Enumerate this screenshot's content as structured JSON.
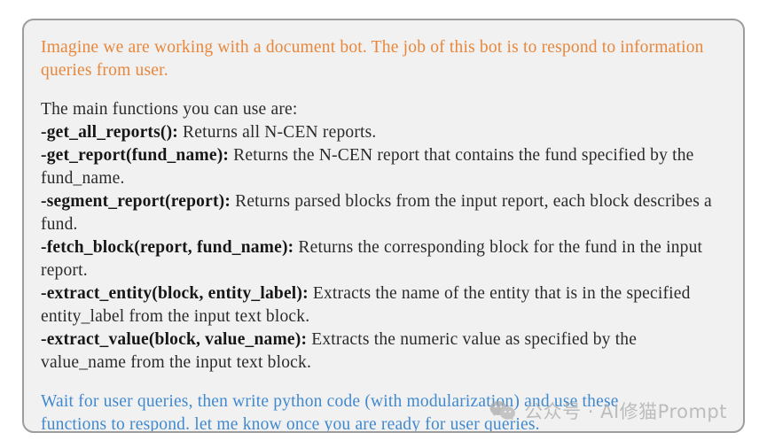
{
  "card": {
    "background_color": "#f1f1f1",
    "border_color": "#9d9d9d"
  },
  "intro": {
    "color": "#e8873c",
    "text": "Imagine we are working with a document bot. The job of this bot is to respond to information queries from user."
  },
  "functions_block": {
    "color": "#2b2b2b",
    "heading": "The main functions you can use are:",
    "items": [
      {
        "signature": "-get_all_reports():",
        "description": " Returns all N-CEN reports."
      },
      {
        "signature": "-get_report(fund_name):",
        "description": " Returns the N-CEN report that contains the fund specified by the fund_name."
      },
      {
        "signature": "-segment_report(report):",
        "description": " Returns parsed blocks from the input report, each block describes a fund."
      },
      {
        "signature": "-fetch_block(report, fund_name):",
        "description": " Returns the corresponding block for the fund in the input report."
      },
      {
        "signature": "-extract_entity(block, entity_label):",
        "description": " Extracts the name of the entity that is in the specified entity_label from the input text block."
      },
      {
        "signature": "-extract_value(block, value_name):",
        "description": " Extracts the numeric value as specified by the value_name from the input text block."
      }
    ]
  },
  "closing": {
    "color": "#4189cf",
    "text": "Wait for user queries, then write python code (with modularization) and use these functions to respond. let me know once you are ready for user queries."
  },
  "watermark": {
    "icon": "wechat-logo-icon",
    "text": "公众号 · AI修猫Prompt",
    "color": "#a8a8a8"
  }
}
